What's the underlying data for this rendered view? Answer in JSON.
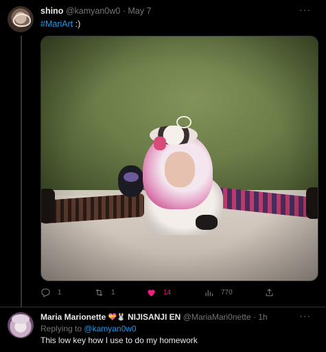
{
  "tweet": {
    "author_name": "shino",
    "handle": "@kamyan0w0",
    "separator": "·",
    "date": "May 7",
    "hashtag": "#MariArt",
    "text_after": " :)",
    "more_label": "···",
    "stats": {
      "replies": "1",
      "retweets": "1",
      "likes": "14",
      "views": "770"
    },
    "liked": true,
    "like_color": "#f91880"
  },
  "reply": {
    "author_name": "Maria Marionette",
    "emoji_label": "💝🐰",
    "org": "NIJISANJI EN",
    "handle": "@MariaMari0nette",
    "separator": "·",
    "time": "1h",
    "replying_prefix": "Replying to",
    "replying_to": "@kamyan0w0",
    "text": "This low key how I use to do my homework",
    "more_label": "···"
  },
  "colors": {
    "background": "#000000",
    "link": "#1d9bf0",
    "muted": "#71767b"
  }
}
